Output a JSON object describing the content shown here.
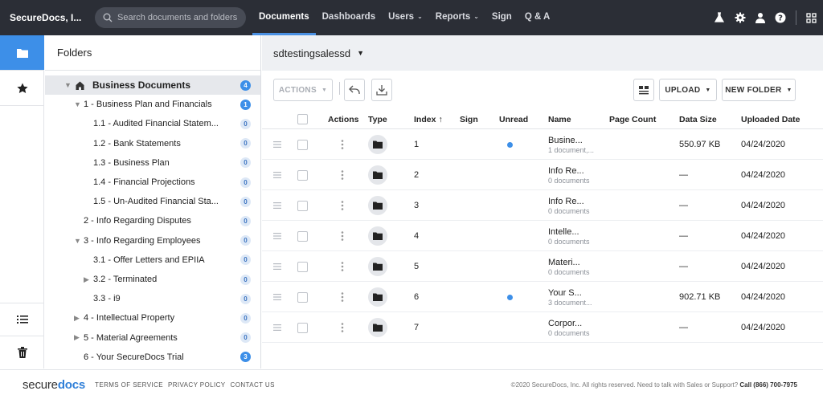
{
  "topbar": {
    "brand": "SecureDocs, I...",
    "search_placeholder": "Search documents and folders",
    "nav": [
      {
        "label": "Documents",
        "active": true,
        "caret": ""
      },
      {
        "label": "Dashboards",
        "active": false,
        "caret": ""
      },
      {
        "label": "Users",
        "active": false,
        "caret": "⌄"
      },
      {
        "label": "Reports",
        "active": false,
        "caret": "⌄"
      },
      {
        "label": "Sign",
        "active": false,
        "caret": ""
      },
      {
        "label": "Q & A",
        "active": false,
        "caret": ""
      }
    ]
  },
  "tree": {
    "title": "Folders",
    "items": [
      {
        "label": "Business Documents",
        "count": "4",
        "arrow": "▼",
        "home": true,
        "selected": true,
        "bold": true,
        "strong_badge": true
      },
      {
        "label": "1 - Business Plan and Financials",
        "count": "1",
        "arrow": "▼",
        "strong_badge": true
      },
      {
        "label": "1.1 - Audited Financial Statem...",
        "count": "0",
        "arrow": ""
      },
      {
        "label": "1.2 - Bank Statements",
        "count": "0",
        "arrow": ""
      },
      {
        "label": "1.3 - Business Plan",
        "count": "0",
        "arrow": ""
      },
      {
        "label": "1.4 - Financial Projections",
        "count": "0",
        "arrow": ""
      },
      {
        "label": "1.5 - Un-Audited Financial Sta...",
        "count": "0",
        "arrow": ""
      },
      {
        "label": "2 - Info Regarding Disputes",
        "count": "0",
        "arrow": ""
      },
      {
        "label": "3 - Info Regarding Employees",
        "count": "0",
        "arrow": "▼"
      },
      {
        "label": "3.1 - Offer Letters and EPIIA",
        "count": "0",
        "arrow": ""
      },
      {
        "label": "3.2 - Terminated",
        "count": "0",
        "arrow": "▶"
      },
      {
        "label": "3.3 - i9",
        "count": "0",
        "arrow": ""
      },
      {
        "label": "4 - Intellectual Property",
        "count": "0",
        "arrow": "▶"
      },
      {
        "label": "5 - Material Agreements",
        "count": "0",
        "arrow": "▶"
      },
      {
        "label": "6 - Your SecureDocs Trial",
        "count": "3",
        "arrow": "",
        "strong_badge": true
      }
    ]
  },
  "main": {
    "folder_name": "sdtestingsalessd",
    "toolbar": {
      "actions_label": "ACTIONS",
      "upload_label": "UPLOAD",
      "new_folder_label": "NEW FOLDER"
    },
    "columns": [
      "Actions",
      "Type",
      "Index",
      "Sign",
      "Unread",
      "Name",
      "Page Count",
      "Data Size",
      "Uploaded Date"
    ],
    "sort_indicator": "↑",
    "rows": [
      {
        "index": "1",
        "unread": true,
        "name": "Busine...",
        "sub": "1 document,...",
        "size": "550.97 KB",
        "date": "04/24/2020"
      },
      {
        "index": "2",
        "unread": false,
        "name": "Info Re...",
        "sub": "0 documents",
        "size": "—",
        "date": "04/24/2020"
      },
      {
        "index": "3",
        "unread": false,
        "name": "Info Re...",
        "sub": "0 documents",
        "size": "—",
        "date": "04/24/2020"
      },
      {
        "index": "4",
        "unread": false,
        "name": "Intelle...",
        "sub": "0 documents",
        "size": "—",
        "date": "04/24/2020"
      },
      {
        "index": "5",
        "unread": false,
        "name": "Materi...",
        "sub": "0 documents",
        "size": "—",
        "date": "04/24/2020"
      },
      {
        "index": "6",
        "unread": true,
        "name": "Your S...",
        "sub": "3 document...",
        "size": "902.71 KB",
        "date": "04/24/2020"
      },
      {
        "index": "7",
        "unread": false,
        "name": "Corpor...",
        "sub": "0 documents",
        "size": "—",
        "date": "04/24/2020"
      }
    ]
  },
  "footer": {
    "logo_plain": "secure",
    "logo_bold": "docs",
    "links": [
      "TERMS OF SERVICE",
      "PRIVACY POLICY",
      "CONTACT US"
    ],
    "copyright": "©2020 SecureDocs, Inc. All rights reserved. Need to talk with Sales or Support?",
    "phone": "Call (866) 700-7975"
  },
  "colors": {
    "accent": "#3d8fe8",
    "topbar": "#2b2e36"
  }
}
